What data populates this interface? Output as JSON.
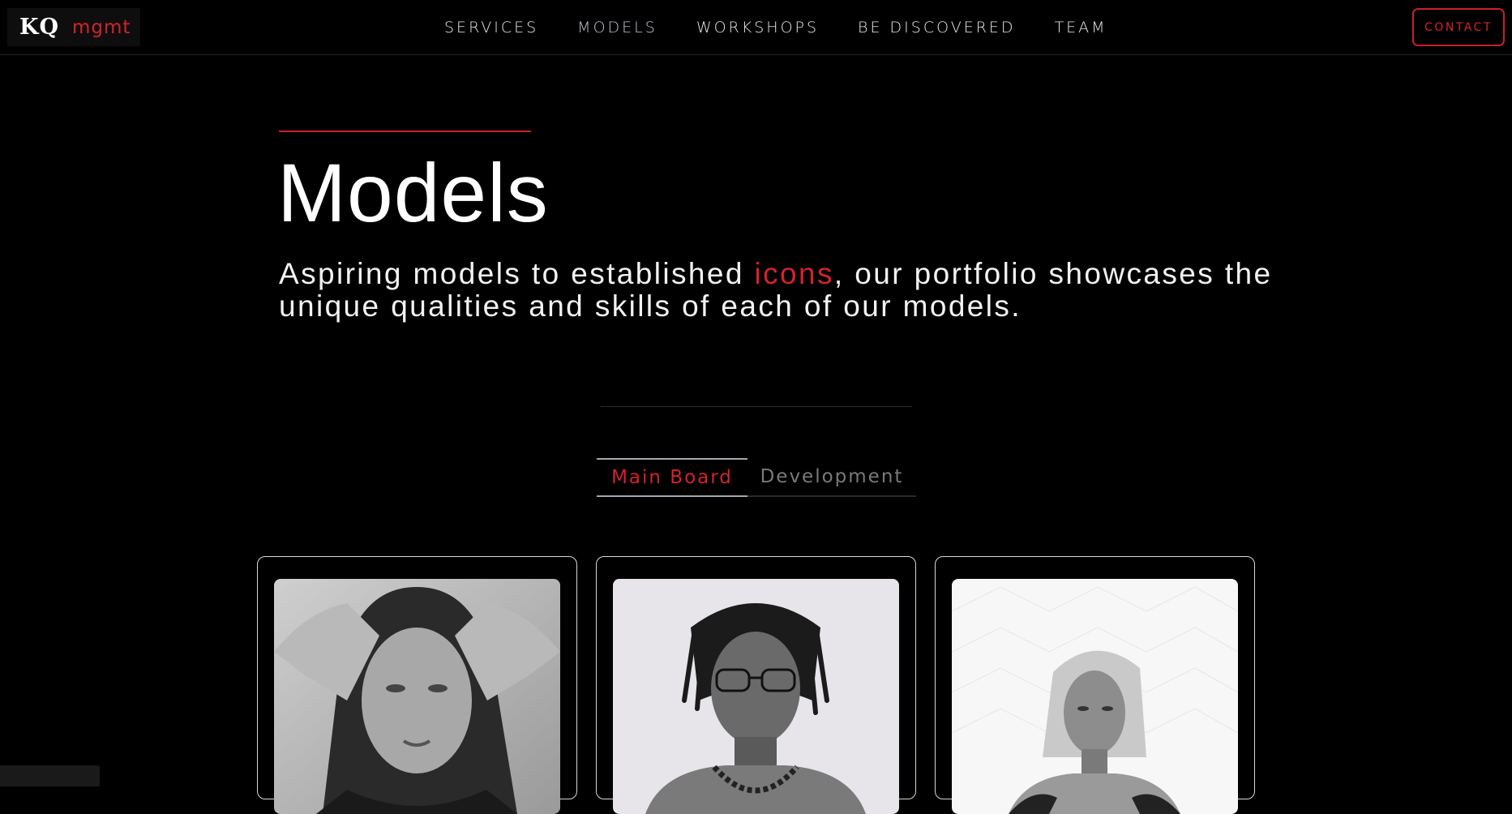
{
  "nav": {
    "logo_primary": "KQ",
    "logo_secondary": "mgmt",
    "items": [
      {
        "label": "SERVICES"
      },
      {
        "label": "MODELS"
      },
      {
        "label": "WORKSHOPS"
      },
      {
        "label": "BE DISCOVERED"
      },
      {
        "label": "TEAM"
      }
    ],
    "contact_label": "CONTACT"
  },
  "hero": {
    "title": "Models",
    "text_before": "Aspiring models to established ",
    "text_accent": "icons",
    "text_after": ", our portfolio showcases the unique qualities and skills of each of our models."
  },
  "tabs": [
    {
      "label": "Main Board",
      "active": true
    },
    {
      "label": "Development",
      "active": false
    }
  ],
  "models": [
    {
      "photo": "model-portrait-1"
    },
    {
      "photo": "model-portrait-2"
    },
    {
      "photo": "model-portrait-3"
    }
  ],
  "colors": {
    "accent": "#d3232a",
    "background": "#000000",
    "text": "#ffffff"
  }
}
